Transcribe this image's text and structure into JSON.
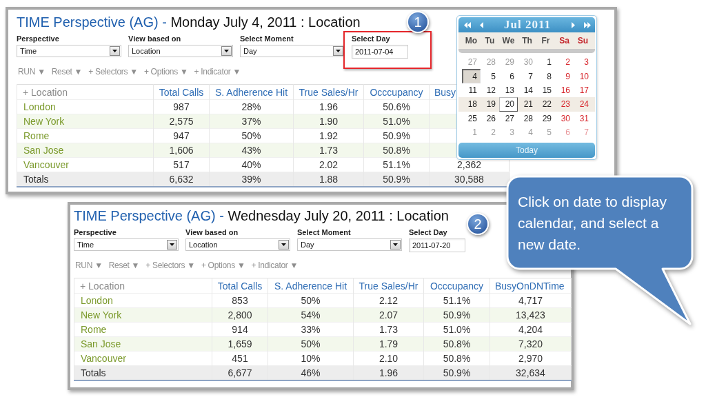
{
  "panels": [
    {
      "title_prefix": "TIME Perspective (AG) -",
      "title": "Monday July 4, 2011 : Location",
      "step": "1",
      "filters": [
        {
          "kind": "select",
          "label": "Perspective",
          "value": "Time",
          "highlighted": false
        },
        {
          "kind": "select",
          "label": "View based on",
          "value": "Location",
          "highlighted": false
        },
        {
          "kind": "select",
          "label": "Select Moment",
          "value": "Day",
          "highlighted": false
        },
        {
          "kind": "date",
          "label": "Select Day",
          "value": "2011-07-04",
          "highlighted": true
        }
      ],
      "toolbar": [
        "RUN ▼",
        "Reset ▼",
        "+ Selectors ▼",
        "+ Options ▼",
        "+ Indicator ▼"
      ],
      "table": {
        "columns": [
          "+ Location",
          "Total Calls",
          "S. Adherence Hit",
          "True Sales/Hr",
          "Occcupancy",
          "Busy"
        ],
        "rows": [
          [
            "London",
            "987",
            "28%",
            "1.96",
            "50.6%"
          ],
          [
            "New York",
            "2,575",
            "37%",
            "1.90",
            "51.0%"
          ],
          [
            "Rome",
            "947",
            "50%",
            "1.92",
            "50.9%"
          ],
          [
            "San Jose",
            "1,606",
            "43%",
            "1.73",
            "50.8%"
          ],
          [
            "Vancouver",
            "517",
            "40%",
            "2.02",
            "51.1%",
            "2,362"
          ]
        ],
        "totals": [
          "Totals",
          "6,632",
          "39%",
          "1.88",
          "50.9%",
          "30,588"
        ]
      }
    },
    {
      "title_prefix": "TIME Perspective (AG) -",
      "title": "Wednesday July 20, 2011 : Location",
      "step": "2",
      "filters": [
        {
          "kind": "select",
          "label": "Perspective",
          "value": "Time",
          "highlighted": false
        },
        {
          "kind": "select",
          "label": "View based on",
          "value": "Location",
          "highlighted": false
        },
        {
          "kind": "select",
          "label": "Select Moment",
          "value": "Day",
          "highlighted": false
        },
        {
          "kind": "date",
          "label": "Select Day",
          "value": "2011-07-20",
          "highlighted": false
        }
      ],
      "toolbar": [
        "RUN ▼",
        "Reset ▼",
        "+ Selectors ▼",
        "+ Options ▼",
        "+ Indicator ▼"
      ],
      "table": {
        "columns": [
          "+ Location",
          "Total Calls",
          "S. Adherence Hit",
          "True Sales/Hr",
          "Occcupancy",
          "BusyOnDNTime"
        ],
        "rows": [
          [
            "London",
            "853",
            "50%",
            "2.12",
            "51.1%",
            "4,717"
          ],
          [
            "New York",
            "2,800",
            "54%",
            "2.07",
            "50.9%",
            "13,423"
          ],
          [
            "Rome",
            "914",
            "33%",
            "1.73",
            "51.0%",
            "4,204"
          ],
          [
            "San Jose",
            "1,659",
            "50%",
            "1.79",
            "50.8%",
            "7,320"
          ],
          [
            "Vancouver",
            "451",
            "10%",
            "2.10",
            "50.8%",
            "2,970"
          ]
        ],
        "totals": [
          "Totals",
          "6,677",
          "46%",
          "1.96",
          "50.9%",
          "32,634"
        ]
      }
    }
  ],
  "calendar": {
    "month": "Jul 2011",
    "weekdays": [
      {
        "label": "Mo",
        "weekend": false
      },
      {
        "label": "Tu",
        "weekend": false
      },
      {
        "label": "We",
        "weekend": false
      },
      {
        "label": "Th",
        "weekend": false
      },
      {
        "label": "Fr",
        "weekend": false
      },
      {
        "label": "Sa",
        "weekend": true
      },
      {
        "label": "Su",
        "weekend": true
      }
    ],
    "weeks": [
      {
        "highlighted": false,
        "days": [
          {
            "day": "27",
            "other_month": true,
            "selected": false,
            "hovered": false
          },
          {
            "day": "28",
            "other_month": true,
            "selected": false,
            "hovered": false
          },
          {
            "day": "29",
            "other_month": true,
            "selected": false,
            "hovered": false
          },
          {
            "day": "30",
            "other_month": true,
            "selected": false,
            "hovered": false
          },
          {
            "day": "1",
            "other_month": false,
            "selected": false,
            "hovered": false
          },
          {
            "day": "2",
            "other_month": false,
            "selected": false,
            "hovered": false
          },
          {
            "day": "3",
            "other_month": false,
            "selected": false,
            "hovered": false
          }
        ]
      },
      {
        "highlighted": false,
        "days": [
          {
            "day": "4",
            "other_month": false,
            "selected": true,
            "hovered": false
          },
          {
            "day": "5",
            "other_month": false,
            "selected": false,
            "hovered": false
          },
          {
            "day": "6",
            "other_month": false,
            "selected": false,
            "hovered": false
          },
          {
            "day": "7",
            "other_month": false,
            "selected": false,
            "hovered": false
          },
          {
            "day": "8",
            "other_month": false,
            "selected": false,
            "hovered": false
          },
          {
            "day": "9",
            "other_month": false,
            "selected": false,
            "hovered": false
          },
          {
            "day": "10",
            "other_month": false,
            "selected": false,
            "hovered": false
          }
        ]
      },
      {
        "highlighted": false,
        "days": [
          {
            "day": "11",
            "other_month": false,
            "selected": false,
            "hovered": false
          },
          {
            "day": "12",
            "other_month": false,
            "selected": false,
            "hovered": false
          },
          {
            "day": "13",
            "other_month": false,
            "selected": false,
            "hovered": false
          },
          {
            "day": "14",
            "other_month": false,
            "selected": false,
            "hovered": false
          },
          {
            "day": "15",
            "other_month": false,
            "selected": false,
            "hovered": false
          },
          {
            "day": "16",
            "other_month": false,
            "selected": false,
            "hovered": false
          },
          {
            "day": "17",
            "other_month": false,
            "selected": false,
            "hovered": false
          }
        ]
      },
      {
        "highlighted": true,
        "days": [
          {
            "day": "18",
            "other_month": false,
            "selected": false,
            "hovered": false
          },
          {
            "day": "19",
            "other_month": false,
            "selected": false,
            "hovered": false
          },
          {
            "day": "20",
            "other_month": false,
            "selected": false,
            "hovered": true
          },
          {
            "day": "21",
            "other_month": false,
            "selected": false,
            "hovered": false
          },
          {
            "day": "22",
            "other_month": false,
            "selected": false,
            "hovered": false
          },
          {
            "day": "23",
            "other_month": false,
            "selected": false,
            "hovered": false
          },
          {
            "day": "24",
            "other_month": false,
            "selected": false,
            "hovered": false
          }
        ]
      },
      {
        "highlighted": false,
        "days": [
          {
            "day": "25",
            "other_month": false,
            "selected": false,
            "hovered": false
          },
          {
            "day": "26",
            "other_month": false,
            "selected": false,
            "hovered": false
          },
          {
            "day": "27",
            "other_month": false,
            "selected": false,
            "hovered": false
          },
          {
            "day": "28",
            "other_month": false,
            "selected": false,
            "hovered": false
          },
          {
            "day": "29",
            "other_month": false,
            "selected": false,
            "hovered": false
          },
          {
            "day": "30",
            "other_month": false,
            "selected": false,
            "hovered": false
          },
          {
            "day": "31",
            "other_month": false,
            "selected": false,
            "hovered": false
          }
        ]
      },
      {
        "highlighted": false,
        "days": [
          {
            "day": "1",
            "other_month": true,
            "selected": false,
            "hovered": false
          },
          {
            "day": "2",
            "other_month": true,
            "selected": false,
            "hovered": false
          },
          {
            "day": "3",
            "other_month": true,
            "selected": false,
            "hovered": false
          },
          {
            "day": "4",
            "other_month": true,
            "selected": false,
            "hovered": false
          },
          {
            "day": "5",
            "other_month": true,
            "selected": false,
            "hovered": false
          },
          {
            "day": "6",
            "other_month": true,
            "selected": false,
            "hovered": false
          },
          {
            "day": "7",
            "other_month": true,
            "selected": false,
            "hovered": false
          }
        ]
      }
    ],
    "today_button": "Today"
  },
  "callout": {
    "text": "Click on date to display calendar, and select a new date."
  }
}
